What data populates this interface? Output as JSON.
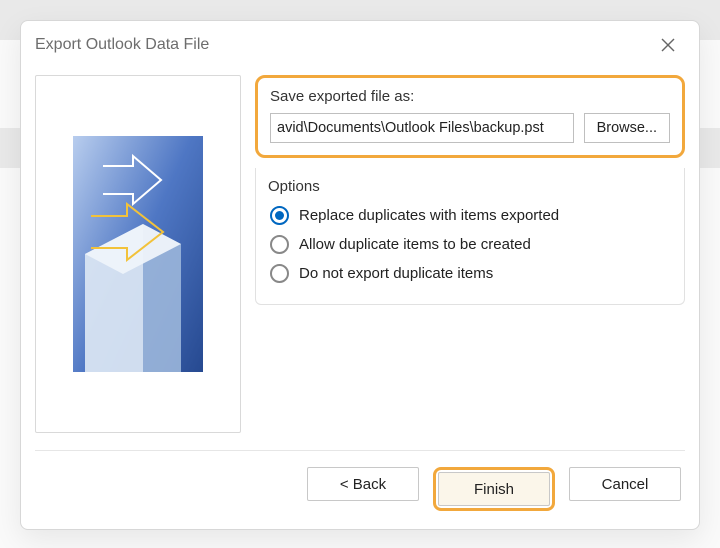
{
  "dialog": {
    "title": "Export Outlook Data File"
  },
  "save": {
    "label": "Save exported file as:",
    "path": "avid\\Documents\\Outlook Files\\backup.pst",
    "browse": "Browse..."
  },
  "options": {
    "title": "Options",
    "items": [
      {
        "label": "Replace duplicates with items exported",
        "selected": true
      },
      {
        "label": "Allow duplicate items to be created",
        "selected": false
      },
      {
        "label": "Do not export duplicate items",
        "selected": false
      }
    ]
  },
  "footer": {
    "back": "< Back",
    "finish": "Finish",
    "cancel": "Cancel"
  }
}
